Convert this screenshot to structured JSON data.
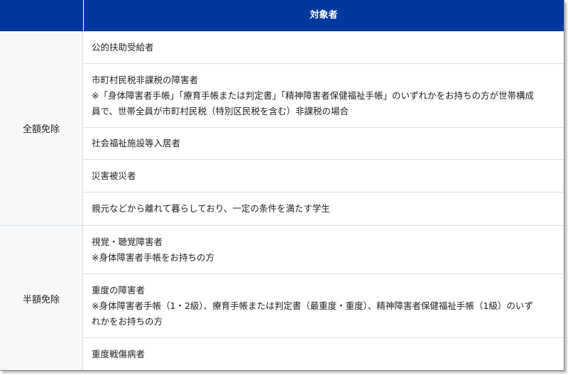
{
  "header": {
    "label": "対象者"
  },
  "groups": [
    {
      "category": "全額免除",
      "items": [
        {
          "lines": [
            "公的扶助受給者"
          ]
        },
        {
          "lines": [
            "市町村民税非課税の障害者",
            "※「身体障害者手帳」「療育手帳または判定書」「精神障害者保健福祉手帳」のいずれかをお持ちの方が世帯構成",
            "員で、世帯全員が市町村民税（特別区民税を含む）非課税の場合"
          ]
        },
        {
          "lines": [
            "社会福祉施設等入居者"
          ]
        },
        {
          "lines": [
            "災害被災者"
          ]
        },
        {
          "lines": [
            "親元などから離れて暮らしており、一定の条件を満たす学生"
          ]
        }
      ]
    },
    {
      "category": "半額免除",
      "items": [
        {
          "lines": [
            "視覚・聴覚障害者",
            "※身体障害者手帳をお持ちの方"
          ]
        },
        {
          "lines": [
            "重度の障害者",
            "※身体障害者手帳（1・2級）、療育手帳または判定書（最重度・重度）、精神障害者保健福祉手帳（1級）のいず",
            "れかをお持ちの方"
          ]
        },
        {
          "lines": [
            "重度戦傷病者"
          ]
        }
      ]
    }
  ],
  "colors": {
    "header_bg": "#00399d",
    "header_text": "#ffffff",
    "grid_line": "#d9dde3",
    "text": "#222222"
  }
}
